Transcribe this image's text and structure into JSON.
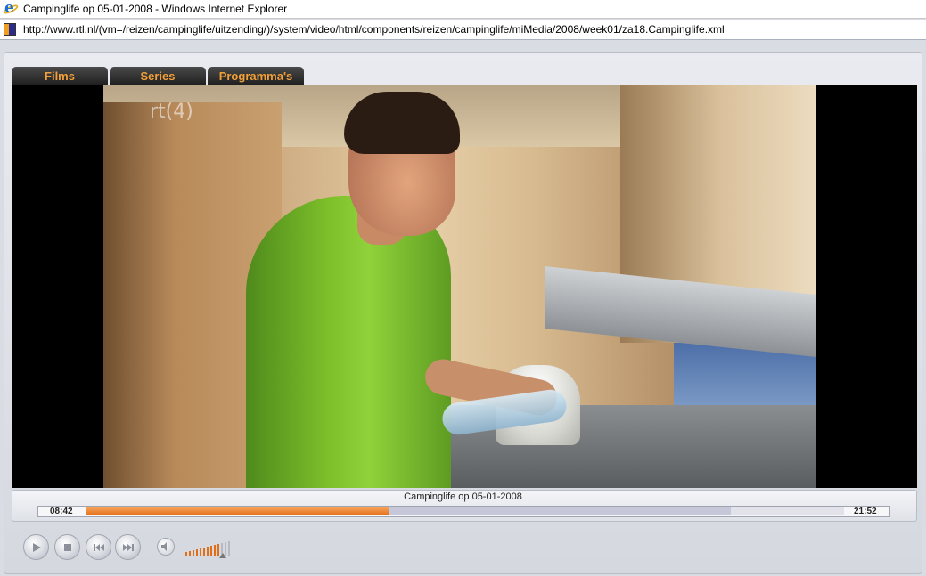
{
  "window": {
    "title": "Campinglife op 05-01-2008 - Windows Internet Explorer",
    "url": "http://www.rtl.nl/(vm=/reizen/campinglife/uitzending/)/system/video/html/components/reizen/campinglife/miMedia/2008/week01/za18.Campinglife.xml"
  },
  "tabs": [
    {
      "label": "Films"
    },
    {
      "label": "Series"
    },
    {
      "label": "Programma's"
    }
  ],
  "video": {
    "watermark": "rt(4)"
  },
  "player": {
    "clip_title": "Campinglife op 05-01-2008",
    "elapsed": "08:42",
    "duration": "21:52",
    "progress_fraction": 0.4,
    "buffered_fraction": 0.85,
    "volume_fraction": 0.7
  },
  "controls": {
    "play_icon": "play-icon",
    "stop_icon": "stop-icon",
    "previous_icon": "previous-icon",
    "next_icon": "next-icon",
    "mute_icon": "speaker-icon"
  },
  "colors": {
    "accent": "#e36e18",
    "tab_text": "#f2a037"
  }
}
